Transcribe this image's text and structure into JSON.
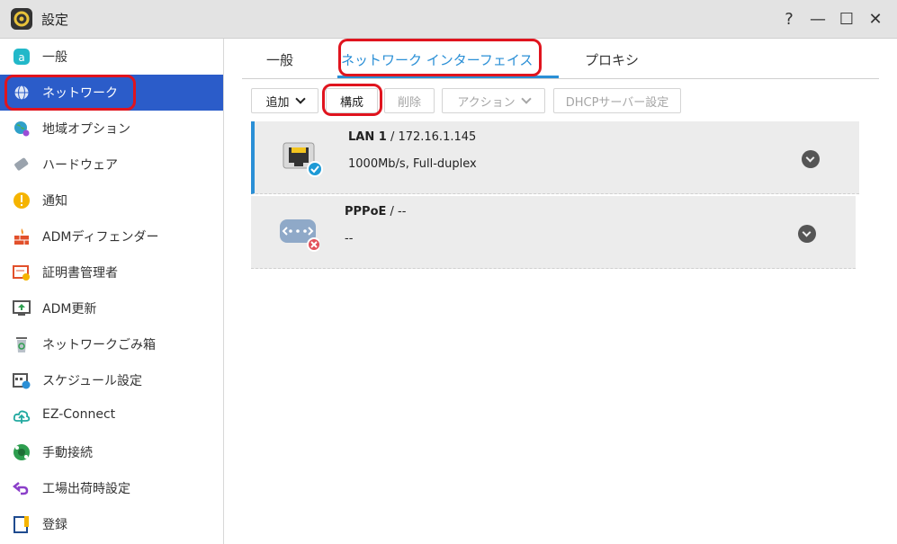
{
  "window": {
    "title": "設定",
    "controls": [
      "?",
      "—",
      "☐",
      "✕"
    ]
  },
  "sidebar": {
    "items": [
      {
        "label": "一般",
        "icon": "general-icon"
      },
      {
        "label": "ネットワーク",
        "icon": "globe-icon",
        "active": true
      },
      {
        "label": "地域オプション",
        "icon": "region-icon"
      },
      {
        "label": "ハードウェア",
        "icon": "hardware-icon"
      },
      {
        "label": "通知",
        "icon": "notification-icon"
      },
      {
        "label": "ADMディフェンダー",
        "icon": "firewall-icon"
      },
      {
        "label": "証明書管理者",
        "icon": "certificate-icon"
      },
      {
        "label": "ADM更新",
        "icon": "update-icon"
      },
      {
        "label": "ネットワークごみ箱",
        "icon": "recycle-bin-icon"
      },
      {
        "label": "スケジュール設定",
        "icon": "schedule-icon"
      },
      {
        "label": "EZ-Connect",
        "icon": "cloud-icon"
      },
      {
        "label": "手動接続",
        "icon": "manual-connect-icon"
      },
      {
        "label": "工場出荷時設定",
        "icon": "reset-icon"
      },
      {
        "label": "登録",
        "icon": "registration-icon"
      }
    ]
  },
  "tabs": {
    "general": "一般",
    "network_interface": "ネットワーク インターフェイス",
    "proxy": "プロキシ"
  },
  "toolbar": {
    "add": "追加",
    "configure": "構成",
    "delete": "削除",
    "action": "アクション",
    "dhcp": "DHCPサーバー設定"
  },
  "interfaces": [
    {
      "name": "LAN 1",
      "detail": "/ 172.16.1.145",
      "status": "1000Mb/s, Full-duplex",
      "icon": "ethernet-port-icon",
      "badge": "connected-check-icon"
    },
    {
      "name": "PPPoE",
      "detail": "/ --",
      "status": "--",
      "icon": "pppoe-icon",
      "badge": "disconnected-x-icon"
    }
  ],
  "colors": {
    "accent": "#2a8fd6",
    "active_sidebar": "#2b5cc9",
    "highlight": "#e0141e"
  }
}
